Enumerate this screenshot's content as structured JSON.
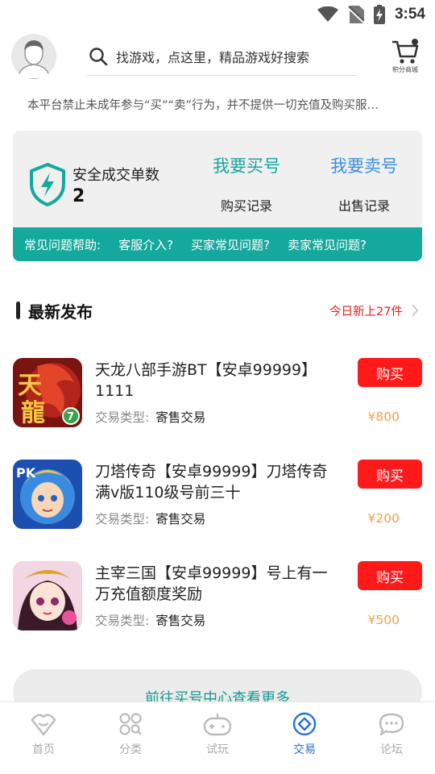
{
  "status_bar": {
    "time": "3:54"
  },
  "header": {
    "search_placeholder": "找游戏，点这里，精品游戏好搜索",
    "shop_label": "积分商城"
  },
  "notice": "本平台禁止未成年参与“买”“卖”行为，并不提供一切充值及购买服…",
  "trade_panel": {
    "safe_label": "安全成交单数",
    "safe_count": "2",
    "buy_title": "我要买号",
    "sell_title": "我要卖号",
    "buy_records": "购买记录",
    "sell_records": "出售记录",
    "buy_color": "#15a89c",
    "sell_color": "#3b8fe0",
    "help": [
      "常见问题帮助:",
      "客服介入?",
      "买家常见问题?",
      "卖家常见问题?"
    ]
  },
  "latest": {
    "title": "最新发布",
    "today_new": "今日新上27件"
  },
  "items": [
    {
      "title": "天龙八部手游BT【安卓99999】1111",
      "type_label": "交易类型:",
      "type_value": "寄售交易",
      "price": "¥800",
      "button": "购买",
      "icon": "tianlong-game-icon"
    },
    {
      "title": "刀塔传奇【安卓99999】刀塔传奇满v版110级号前三十",
      "type_label": "交易类型:",
      "type_value": "寄售交易",
      "price": "¥200",
      "button": "购买",
      "icon": "daota-game-icon"
    },
    {
      "title": "主宰三国【安卓99999】号上有一万充值额度奖励",
      "type_label": "交易类型:",
      "type_value": "寄售交易",
      "price": "¥500",
      "button": "购买",
      "icon": "zhuzai-game-icon"
    }
  ],
  "more_button": "前往买号中心查看更多",
  "tabs": [
    {
      "label": "首页",
      "icon": "home-icon",
      "active": false
    },
    {
      "label": "分类",
      "icon": "category-icon",
      "active": false
    },
    {
      "label": "试玩",
      "icon": "gamepad-icon",
      "active": false
    },
    {
      "label": "交易",
      "icon": "trade-icon",
      "active": true
    },
    {
      "label": "论坛",
      "icon": "forum-icon",
      "active": false
    }
  ]
}
